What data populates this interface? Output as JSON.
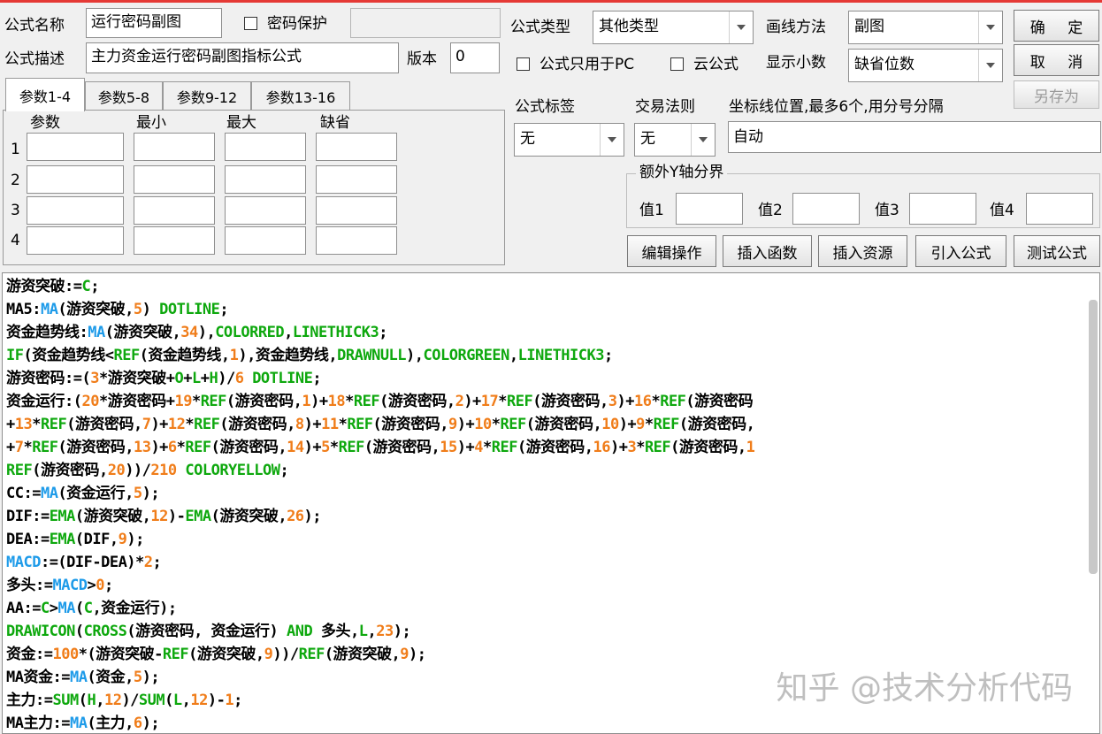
{
  "colors": {
    "keyword": "#1e9be9",
    "constant": "#0ea80e",
    "number": "#f07d1a",
    "text": "#000000"
  },
  "row1": {
    "name_label": "公式名称",
    "name_value": "运行密码副图",
    "password_label": "密码保护",
    "type_label": "公式类型",
    "type_value": "其他类型",
    "draw_label": "画线方法",
    "draw_value": "副图"
  },
  "row2": {
    "desc_label": "公式描述",
    "desc_value": "主力资金运行密码副图指标公式",
    "version_label": "版本",
    "version_value": "0",
    "pc_only_label": "公式只用于PC",
    "cloud_label": "云公式",
    "decimals_label": "显示小数",
    "decimals_value": "缺省位数"
  },
  "buttons": {
    "ok": "确 定",
    "cancel": "取 消",
    "save_as": "另存为"
  },
  "tabs": [
    "参数1-4",
    "参数5-8",
    "参数9-12",
    "参数13-16"
  ],
  "params": {
    "headers": [
      "参数",
      "最小",
      "最大",
      "缺省"
    ],
    "rows": [
      "1",
      "2",
      "3",
      "4"
    ]
  },
  "tag_label": "公式标签",
  "tag_value": "无",
  "rule_label": "交易法则",
  "rule_value": "无",
  "axis_label": "坐标线位置,最多6个,用分号分隔",
  "axis_value": "自动",
  "extra_y": {
    "title": "额外Y轴分界",
    "v1": "值1",
    "v2": "值2",
    "v3": "值3",
    "v4": "值4"
  },
  "toolbar": [
    "编辑操作",
    "插入函数",
    "插入资源",
    "引入公式",
    "测试公式"
  ],
  "code_lines": [
    [
      [
        "游资突破:=",
        "t"
      ],
      [
        "C",
        "c"
      ],
      [
        ";",
        "t"
      ]
    ],
    [
      [
        "MA5:",
        "t"
      ],
      [
        "MA",
        "k"
      ],
      [
        "(游资突破,",
        "t"
      ],
      [
        "5",
        "n"
      ],
      [
        ") ",
        "t"
      ],
      [
        "DOTLINE",
        "c"
      ],
      [
        ";",
        "t"
      ]
    ],
    [
      [
        "资金趋势线:",
        "t"
      ],
      [
        "MA",
        "k"
      ],
      [
        "(游资突破,",
        "t"
      ],
      [
        "34",
        "n"
      ],
      [
        "),",
        "t"
      ],
      [
        "COLORRED",
        "c"
      ],
      [
        ",",
        "t"
      ],
      [
        "LINETHICK3",
        "c"
      ],
      [
        ";",
        "t"
      ]
    ],
    [
      [
        "IF",
        "c"
      ],
      [
        "(资金趋势线<",
        "t"
      ],
      [
        "REF",
        "c"
      ],
      [
        "(资金趋势线,",
        "t"
      ],
      [
        "1",
        "n"
      ],
      [
        "),资金趋势线,",
        "t"
      ],
      [
        "DRAWNULL",
        "c"
      ],
      [
        "),",
        "t"
      ],
      [
        "COLORGREEN",
        "c"
      ],
      [
        ",",
        "t"
      ],
      [
        "LINETHICK3",
        "c"
      ],
      [
        ";",
        "t"
      ]
    ],
    [
      [
        "游资密码:=(",
        "t"
      ],
      [
        "3",
        "n"
      ],
      [
        "*游资突破+",
        "t"
      ],
      [
        "O",
        "c"
      ],
      [
        "+",
        "t"
      ],
      [
        "L",
        "c"
      ],
      [
        "+",
        "t"
      ],
      [
        "H",
        "c"
      ],
      [
        ")/",
        "t"
      ],
      [
        "6",
        "n"
      ],
      [
        " ",
        "t"
      ],
      [
        "DOTLINE",
        "c"
      ],
      [
        ";",
        "t"
      ]
    ],
    [
      [
        "资金运行:(",
        "t"
      ],
      [
        "20",
        "n"
      ],
      [
        "*游资密码+",
        "t"
      ],
      [
        "19",
        "n"
      ],
      [
        "*",
        "t"
      ],
      [
        "REF",
        "c"
      ],
      [
        "(游资密码,",
        "t"
      ],
      [
        "1",
        "n"
      ],
      [
        ")+",
        "t"
      ],
      [
        "18",
        "n"
      ],
      [
        "*",
        "t"
      ],
      [
        "REF",
        "c"
      ],
      [
        "(游资密码,",
        "t"
      ],
      [
        "2",
        "n"
      ],
      [
        ")+",
        "t"
      ],
      [
        "17",
        "n"
      ],
      [
        "*",
        "t"
      ],
      [
        "REF",
        "c"
      ],
      [
        "(游资密码,",
        "t"
      ],
      [
        "3",
        "n"
      ],
      [
        ")+",
        "t"
      ],
      [
        "16",
        "n"
      ],
      [
        "*",
        "t"
      ],
      [
        "REF",
        "c"
      ],
      [
        "(游资密码",
        "t"
      ]
    ],
    [
      [
        "+",
        "t"
      ],
      [
        "13",
        "n"
      ],
      [
        "*",
        "t"
      ],
      [
        "REF",
        "c"
      ],
      [
        "(游资密码,",
        "t"
      ],
      [
        "7",
        "n"
      ],
      [
        ")+",
        "t"
      ],
      [
        "12",
        "n"
      ],
      [
        "*",
        "t"
      ],
      [
        "REF",
        "c"
      ],
      [
        "(游资密码,",
        "t"
      ],
      [
        "8",
        "n"
      ],
      [
        ")+",
        "t"
      ],
      [
        "11",
        "n"
      ],
      [
        "*",
        "t"
      ],
      [
        "REF",
        "c"
      ],
      [
        "(游资密码,",
        "t"
      ],
      [
        "9",
        "n"
      ],
      [
        ")+",
        "t"
      ],
      [
        "10",
        "n"
      ],
      [
        "*",
        "t"
      ],
      [
        "REF",
        "c"
      ],
      [
        "(游资密码,",
        "t"
      ],
      [
        "10",
        "n"
      ],
      [
        ")+",
        "t"
      ],
      [
        "9",
        "n"
      ],
      [
        "*",
        "t"
      ],
      [
        "REF",
        "c"
      ],
      [
        "(游资密码,",
        "t"
      ]
    ],
    [
      [
        "+",
        "t"
      ],
      [
        "7",
        "n"
      ],
      [
        "*",
        "t"
      ],
      [
        "REF",
        "c"
      ],
      [
        "(游资密码,",
        "t"
      ],
      [
        "13",
        "n"
      ],
      [
        ")+",
        "t"
      ],
      [
        "6",
        "n"
      ],
      [
        "*",
        "t"
      ],
      [
        "REF",
        "c"
      ],
      [
        "(游资密码,",
        "t"
      ],
      [
        "14",
        "n"
      ],
      [
        ")+",
        "t"
      ],
      [
        "5",
        "n"
      ],
      [
        "*",
        "t"
      ],
      [
        "REF",
        "c"
      ],
      [
        "(游资密码,",
        "t"
      ],
      [
        "15",
        "n"
      ],
      [
        ")+",
        "t"
      ],
      [
        "4",
        "n"
      ],
      [
        "*",
        "t"
      ],
      [
        "REF",
        "c"
      ],
      [
        "(游资密码,",
        "t"
      ],
      [
        "16",
        "n"
      ],
      [
        ")+",
        "t"
      ],
      [
        "3",
        "n"
      ],
      [
        "*",
        "t"
      ],
      [
        "REF",
        "c"
      ],
      [
        "(游资密码,",
        "t"
      ],
      [
        "1",
        "n"
      ]
    ],
    [
      [
        "REF",
        "c"
      ],
      [
        "(游资密码,",
        "t"
      ],
      [
        "20",
        "n"
      ],
      [
        "))/",
        "t"
      ],
      [
        "210",
        "n"
      ],
      [
        " ",
        "t"
      ],
      [
        "COLORYELLOW",
        "c"
      ],
      [
        ";",
        "t"
      ]
    ],
    [
      [
        "CC:=",
        "t"
      ],
      [
        "MA",
        "k"
      ],
      [
        "(资金运行,",
        "t"
      ],
      [
        "5",
        "n"
      ],
      [
        ");",
        "t"
      ]
    ],
    [
      [
        "DIF:=",
        "t"
      ],
      [
        "EMA",
        "c"
      ],
      [
        "(游资突破,",
        "t"
      ],
      [
        "12",
        "n"
      ],
      [
        ")-",
        "t"
      ],
      [
        "EMA",
        "c"
      ],
      [
        "(游资突破,",
        "t"
      ],
      [
        "26",
        "n"
      ],
      [
        ");",
        "t"
      ]
    ],
    [
      [
        "DEA:=",
        "t"
      ],
      [
        "EMA",
        "c"
      ],
      [
        "(DIF,",
        "t"
      ],
      [
        "9",
        "n"
      ],
      [
        ");",
        "t"
      ]
    ],
    [
      [
        "MACD",
        "k"
      ],
      [
        ":=(DIF-DEA)*",
        "t"
      ],
      [
        "2",
        "n"
      ],
      [
        ";",
        "t"
      ]
    ],
    [
      [
        "多头:=",
        "t"
      ],
      [
        "MACD",
        "k"
      ],
      [
        ">",
        "t"
      ],
      [
        "0",
        "n"
      ],
      [
        ";",
        "t"
      ]
    ],
    [
      [
        "AA:=",
        "t"
      ],
      [
        "C",
        "c"
      ],
      [
        ">",
        "t"
      ],
      [
        "MA",
        "k"
      ],
      [
        "(",
        "t"
      ],
      [
        "C",
        "c"
      ],
      [
        ",资金运行);",
        "t"
      ]
    ],
    [
      [
        "DRAWICON",
        "c"
      ],
      [
        "(",
        "t"
      ],
      [
        "CROSS",
        "c"
      ],
      [
        "(游资密码, 资金运行) ",
        "t"
      ],
      [
        "AND",
        "c"
      ],
      [
        " 多头,",
        "t"
      ],
      [
        "L",
        "c"
      ],
      [
        ",",
        "t"
      ],
      [
        "23",
        "n"
      ],
      [
        ");",
        "t"
      ]
    ],
    [
      [
        "资金:=",
        "t"
      ],
      [
        "100",
        "n"
      ],
      [
        "*(游资突破-",
        "t"
      ],
      [
        "REF",
        "c"
      ],
      [
        "(游资突破,",
        "t"
      ],
      [
        "9",
        "n"
      ],
      [
        "))/",
        "t"
      ],
      [
        "REF",
        "c"
      ],
      [
        "(游资突破,",
        "t"
      ],
      [
        "9",
        "n"
      ],
      [
        ");",
        "t"
      ]
    ],
    [
      [
        "MA资金:=",
        "t"
      ],
      [
        "MA",
        "k"
      ],
      [
        "(资金,",
        "t"
      ],
      [
        "5",
        "n"
      ],
      [
        ");",
        "t"
      ]
    ],
    [
      [
        "主力:=",
        "t"
      ],
      [
        "SUM",
        "c"
      ],
      [
        "(",
        "t"
      ],
      [
        "H",
        "c"
      ],
      [
        ",",
        "t"
      ],
      [
        "12",
        "n"
      ],
      [
        ")/",
        "t"
      ],
      [
        "SUM",
        "c"
      ],
      [
        "(",
        "t"
      ],
      [
        "L",
        "c"
      ],
      [
        ",",
        "t"
      ],
      [
        "12",
        "n"
      ],
      [
        ")-",
        "t"
      ],
      [
        "1",
        "n"
      ],
      [
        ";",
        "t"
      ]
    ],
    [
      [
        "MA主力:=",
        "t"
      ],
      [
        "MA",
        "k"
      ],
      [
        "(主力,",
        "t"
      ],
      [
        "6",
        "n"
      ],
      [
        ");",
        "t"
      ]
    ]
  ],
  "watermark": "知乎 @技术分析代码"
}
